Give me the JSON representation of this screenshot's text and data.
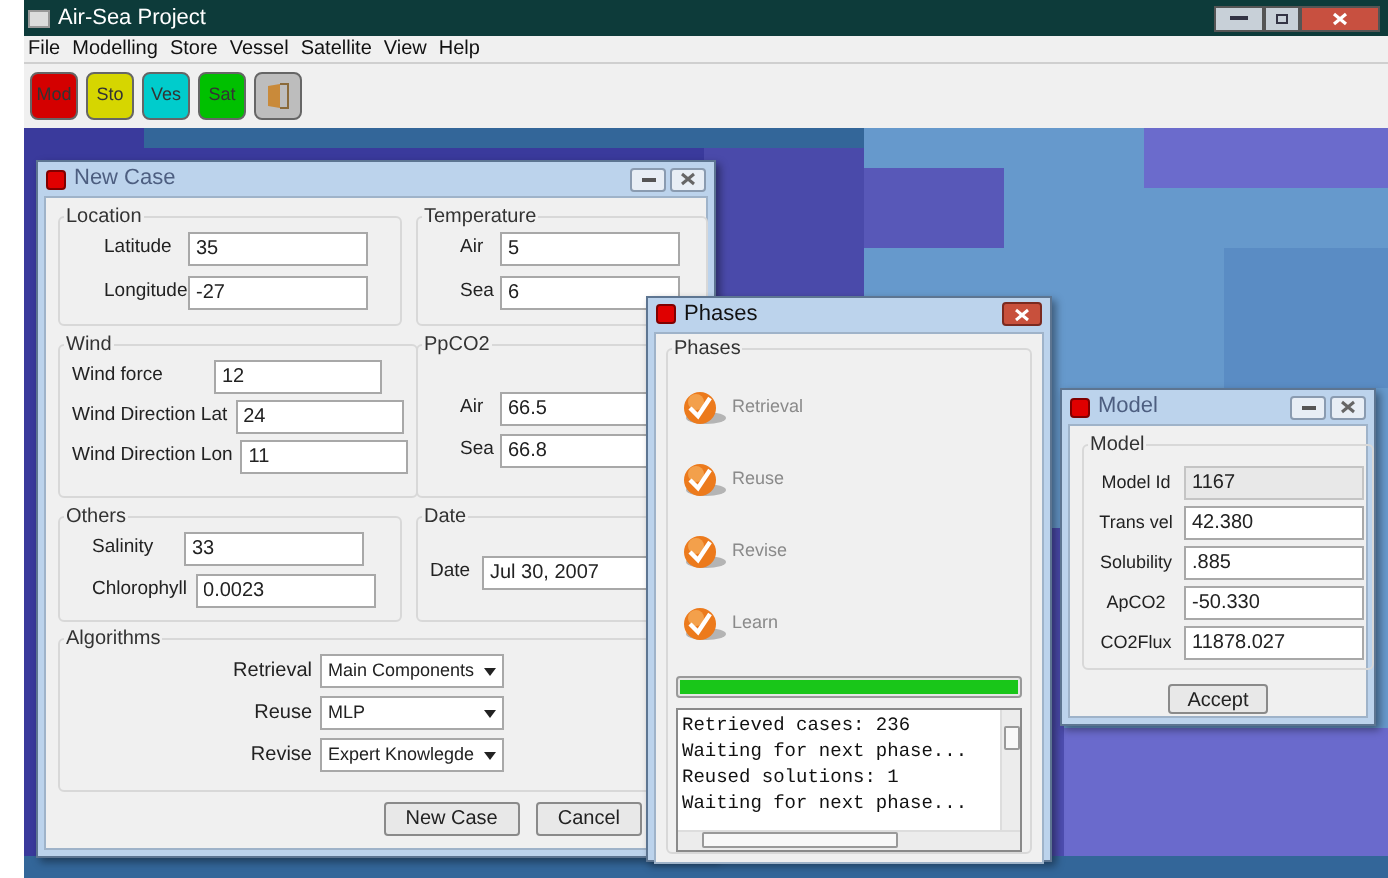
{
  "window": {
    "title": "Air-Sea Project"
  },
  "menu": [
    "File",
    "Modelling",
    "Store",
    "Vessel",
    "Satellite",
    "View",
    "Help"
  ],
  "toolbar": [
    {
      "kind": "text",
      "label": "Mod",
      "color": "#d40000"
    },
    {
      "kind": "text",
      "label": "Sto",
      "color": "#d6d600"
    },
    {
      "kind": "text",
      "label": "Ves",
      "color": "#00cccc"
    },
    {
      "kind": "text",
      "label": "Sat",
      "color": "#00c000"
    },
    {
      "kind": "icon",
      "color": "#bdbdbd"
    }
  ],
  "new_case": {
    "title": "New Case",
    "groups": [
      {
        "title": "Location",
        "fields": [
          {
            "label": "Latitude",
            "value": "35"
          },
          {
            "label": "Longitude",
            "value": "-27"
          }
        ]
      },
      {
        "title": "Temperature",
        "fields": [
          {
            "label": "Air",
            "value": "5"
          },
          {
            "label": "Sea",
            "value": "6"
          }
        ]
      },
      {
        "title": "Wind",
        "fields": [
          {
            "label": "Wind force",
            "value": "12"
          },
          {
            "label": "Wind Direction Lat",
            "value": "24"
          },
          {
            "label": "Wind Direction Lon",
            "value": "11"
          }
        ]
      },
      {
        "title": "PpCO2",
        "fields": [
          {
            "label": "Air",
            "value": "66.5"
          },
          {
            "label": "Sea",
            "value": "66.8"
          }
        ]
      },
      {
        "title": "Others",
        "fields": [
          {
            "label": "Salinity",
            "value": "33"
          },
          {
            "label": "Chlorophyll",
            "value": "0.0023"
          }
        ]
      },
      {
        "title": "Date",
        "fields": [
          {
            "label": "Date",
            "value": "Jul 30, 2007"
          }
        ]
      }
    ],
    "algorithms": {
      "title": "Algorithms",
      "selects": [
        {
          "label": "Retrieval",
          "value": "Main Components"
        },
        {
          "label": "Reuse",
          "value": "MLP"
        },
        {
          "label": "Revise",
          "value": "Expert Knowlegde"
        }
      ]
    },
    "buttons": [
      "New Case",
      "Cancel"
    ]
  },
  "phases": {
    "title": "Phases",
    "group_title": "Phases",
    "steps": [
      {
        "label": "Retrieval",
        "done": true
      },
      {
        "label": "Reuse",
        "done": true
      },
      {
        "label": "Revise",
        "done": true
      },
      {
        "label": "Learn",
        "done": true
      }
    ],
    "progress": {
      "level": 1
    },
    "log": [
      "Retrieved cases: 236",
      "Waiting for next phase...",
      "Reused solutions: 1",
      "Waiting for next phase..."
    ]
  },
  "model": {
    "title": "Model",
    "group_title": "Model",
    "fields": [
      {
        "label": "Model Id",
        "value": "1167",
        "disabled": true
      },
      {
        "label": "Trans vel",
        "value": "42.380",
        "disabled": false
      },
      {
        "label": "Solubility",
        "value": ".885",
        "disabled": false
      },
      {
        "label": "ApCO2",
        "value": "-50.330",
        "disabled": false
      },
      {
        "label": "CO2Flux",
        "value": "11878.027",
        "disabled": false
      }
    ],
    "button": "Accept"
  }
}
